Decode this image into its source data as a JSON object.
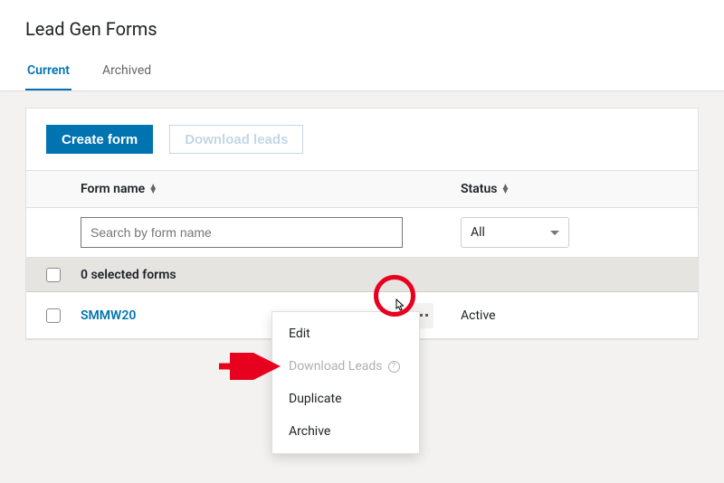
{
  "header": {
    "title": "Lead Gen Forms"
  },
  "tabs": {
    "current": "Current",
    "archived": "Archived"
  },
  "toolbar": {
    "create_form": "Create form",
    "download_leads": "Download leads"
  },
  "table": {
    "columns": {
      "form_name": "Form name",
      "status": "Status"
    },
    "search_placeholder": "Search by form name",
    "status_filter": "All",
    "selected_summary": "0 selected forms",
    "rows": [
      {
        "name": "SMMW20",
        "status": "Active"
      }
    ]
  },
  "menu": {
    "edit": "Edit",
    "download_leads": "Download Leads",
    "duplicate": "Duplicate",
    "archive": "Archive"
  }
}
